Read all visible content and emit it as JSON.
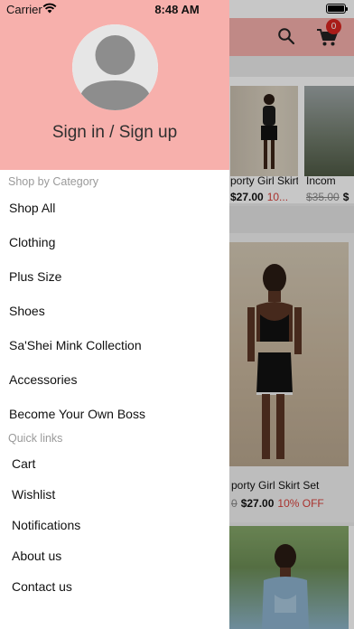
{
  "status_bar": {
    "carrier": "Carrier",
    "time": "8:48 AM"
  },
  "header": {
    "cart_count": "0",
    "brand_color": "#f7b0ac"
  },
  "products": [
    {
      "name": "porty Girl Skirt Set",
      "old_price": "",
      "price": "$27.00",
      "discount": "10..."
    },
    {
      "name": "Incom",
      "old_price": "$35.00",
      "price": "$",
      "discount": ""
    },
    {
      "name": "porty Girl Skirt Set",
      "old_price": "0",
      "price": "$27.00",
      "discount": "10% OFF"
    }
  ],
  "drawer": {
    "sign_in": "Sign in / Sign up",
    "shop_section": "Shop by Category",
    "categories": [
      {
        "label": "Shop All"
      },
      {
        "label": "Clothing"
      },
      {
        "label": "Plus Size"
      },
      {
        "label": "Shoes"
      },
      {
        "label": "Sa'Shei Mink Collection"
      },
      {
        "label": "Accessories"
      },
      {
        "label": "Become Your Own Boss"
      }
    ],
    "quick_section": "Quick links",
    "quick_links": [
      {
        "label": "Cart"
      },
      {
        "label": "Wishlist"
      },
      {
        "label": "Notifications"
      },
      {
        "label": "About us"
      },
      {
        "label": "Contact us"
      }
    ]
  }
}
